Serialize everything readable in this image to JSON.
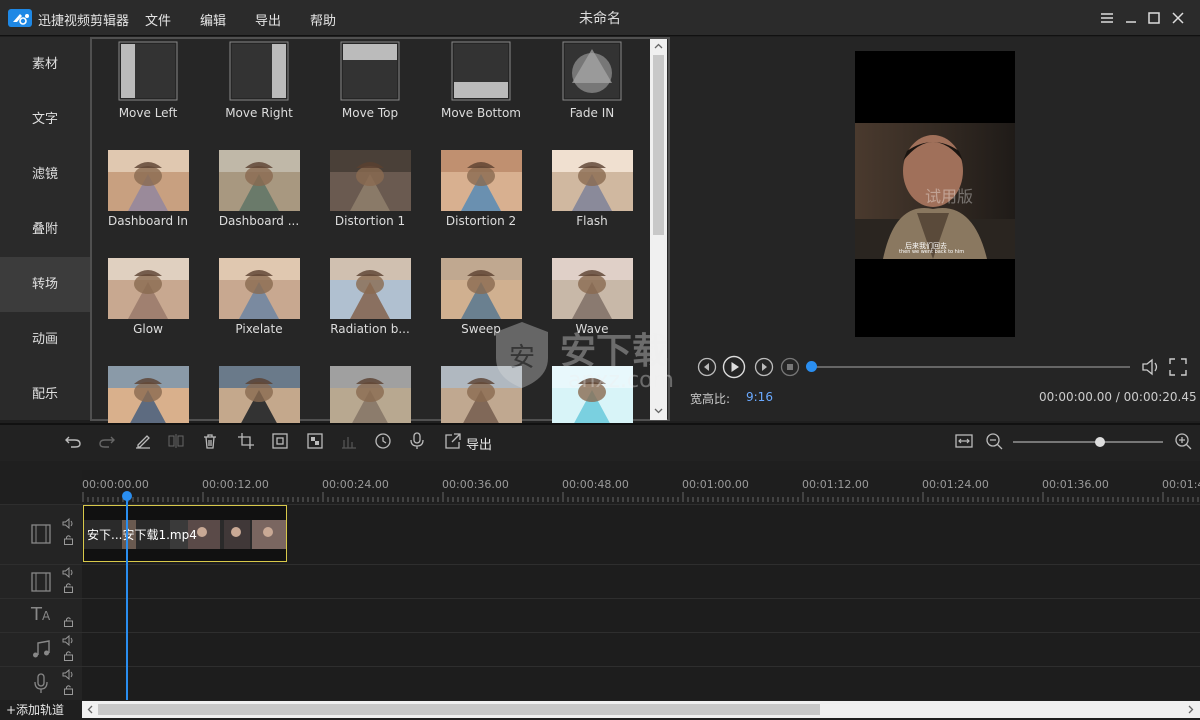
{
  "app": {
    "name": "迅捷视频剪辑器",
    "document_title": "未命名"
  },
  "menu": [
    "文件",
    "编辑",
    "导出",
    "帮助"
  ],
  "sidebar": {
    "items": [
      "素材",
      "文字",
      "滤镜",
      "叠附",
      "转场",
      "动画",
      "配乐"
    ],
    "active": "转场"
  },
  "transitions": [
    {
      "label": "Move Left",
      "icon": "move-left-icon"
    },
    {
      "label": "Move Right",
      "icon": "move-right-icon"
    },
    {
      "label": "Move Top",
      "icon": "move-top-icon"
    },
    {
      "label": "Move Bottom",
      "icon": "move-bottom-icon"
    },
    {
      "label": "Fade IN",
      "icon": "fade-in-icon"
    },
    {
      "label": "Dashboard In"
    },
    {
      "label": "Dashboard ..."
    },
    {
      "label": "Distortion 1"
    },
    {
      "label": "Distortion 2"
    },
    {
      "label": "Flash"
    },
    {
      "label": "Glow"
    },
    {
      "label": "Pixelate"
    },
    {
      "label": "Radiation b..."
    },
    {
      "label": "Sweep"
    },
    {
      "label": "Wave"
    },
    {
      "label": ""
    },
    {
      "label": ""
    },
    {
      "label": ""
    },
    {
      "label": ""
    },
    {
      "label": ""
    }
  ],
  "preview": {
    "aspect_label": "宽高比:",
    "aspect_value": "9:16",
    "time": "00:00:00.00 / 00:00:20.45",
    "watermark": "试用版",
    "subtitle_cn": "后来我们回去",
    "subtitle_en": "then we went back to him",
    "progress": 0.0
  },
  "overlay_logo": {
    "text": "安下载",
    "domain": "anxz.com"
  },
  "toolbar": {
    "export_label": "导出",
    "zoom": 0.58
  },
  "timeline": {
    "ruler": [
      "00:00:00.00",
      "00:00:12.00",
      "00:00:24.00",
      "00:00:36.00",
      "00:00:48.00",
      "00:01:00.00",
      "00:01:12.00",
      "00:01:24.00",
      "00:01:36.00",
      "00:01:4"
    ],
    "clip_label": "安下...安下载1.mp4",
    "add_track": "+添加轨道"
  },
  "colors": {
    "accent": "#2a8ef0",
    "aspect": "#6aa9ff",
    "clip_border": "#d8c94a"
  }
}
